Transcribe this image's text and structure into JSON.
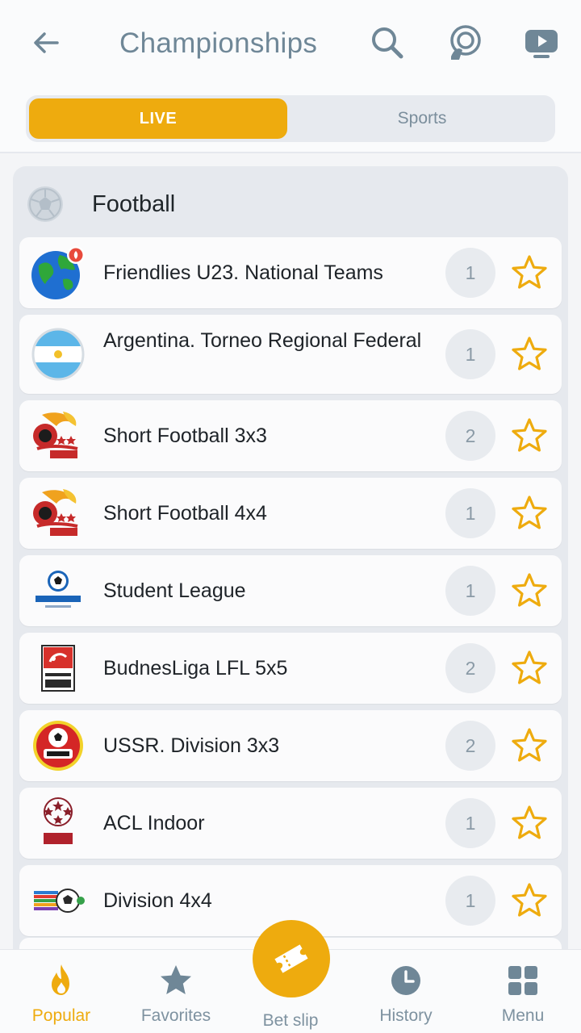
{
  "header": {
    "title": "Championships",
    "back_icon": "back-arrow-icon",
    "search_icon": "search-icon",
    "live_icon": "live-stream-icon",
    "video_icon": "video-icon"
  },
  "tabs": {
    "live_label": "LIVE",
    "sports_label": "Sports",
    "active": "LIVE"
  },
  "section": {
    "title": "Football",
    "icon": "football-icon"
  },
  "championships": [
    {
      "name": "Friendlies U23. National Teams",
      "count": "1",
      "logo": "globe-icon"
    },
    {
      "name": "Argentina. Torneo Regional Federal",
      "count": "1",
      "logo": "argentina-flag-icon"
    },
    {
      "name": "Short Football 3x3",
      "count": "2",
      "logo": "short-football-logo"
    },
    {
      "name": "Short Football 4x4",
      "count": "1",
      "logo": "short-football-logo"
    },
    {
      "name": "Student League",
      "count": "1",
      "logo": "student-league-logo"
    },
    {
      "name": "BudnesLiga LFL 5x5",
      "count": "2",
      "logo": "budnesliga-logo"
    },
    {
      "name": "USSR. Division 3x3",
      "count": "2",
      "logo": "ussr-logo"
    },
    {
      "name": "ACL Indoor",
      "count": "1",
      "logo": "acl-logo"
    },
    {
      "name": "Division 4x4",
      "count": "1",
      "logo": "division-logo"
    }
  ],
  "nav": {
    "popular": "Popular",
    "favorites": "Favorites",
    "betslip": "Bet slip",
    "history": "History",
    "menu": "Menu",
    "active": "Popular"
  },
  "colors": {
    "accent": "#eeab0e",
    "muted": "#7e92a0",
    "title": "#6f8797"
  }
}
